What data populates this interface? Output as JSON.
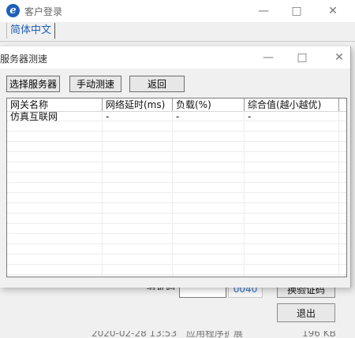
{
  "parent_window": {
    "title": "客户登录",
    "language_tab": "简体中文",
    "captcha_partial_label": "验证码",
    "captcha_value": "0040",
    "refresh_captcha_button": "换验证码",
    "exit_button": "退出",
    "bottom_text_date": "2020-02-28 13:53",
    "bottom_text_type": "应用程序扩展",
    "bottom_text_size": "196 KB"
  },
  "dialog": {
    "title": "服务器测速",
    "buttons": {
      "select_server": "选择服务器",
      "manual_test": "手动测速",
      "back": "返回"
    },
    "table": {
      "columns": [
        "网关名称",
        "网络延时(ms)",
        "负载(%)",
        "综合值(越小越优)"
      ],
      "rows": [
        [
          "仿真互联网",
          "-",
          "-",
          "-"
        ]
      ]
    }
  },
  "title_bar_icons": [
    "minimize-icon",
    "maximize-icon",
    "close-icon"
  ],
  "colors": {
    "accent_blue": "#1f5fb8",
    "captcha_blue": "#3373d0",
    "dialog_background": "#f0f0f0"
  }
}
